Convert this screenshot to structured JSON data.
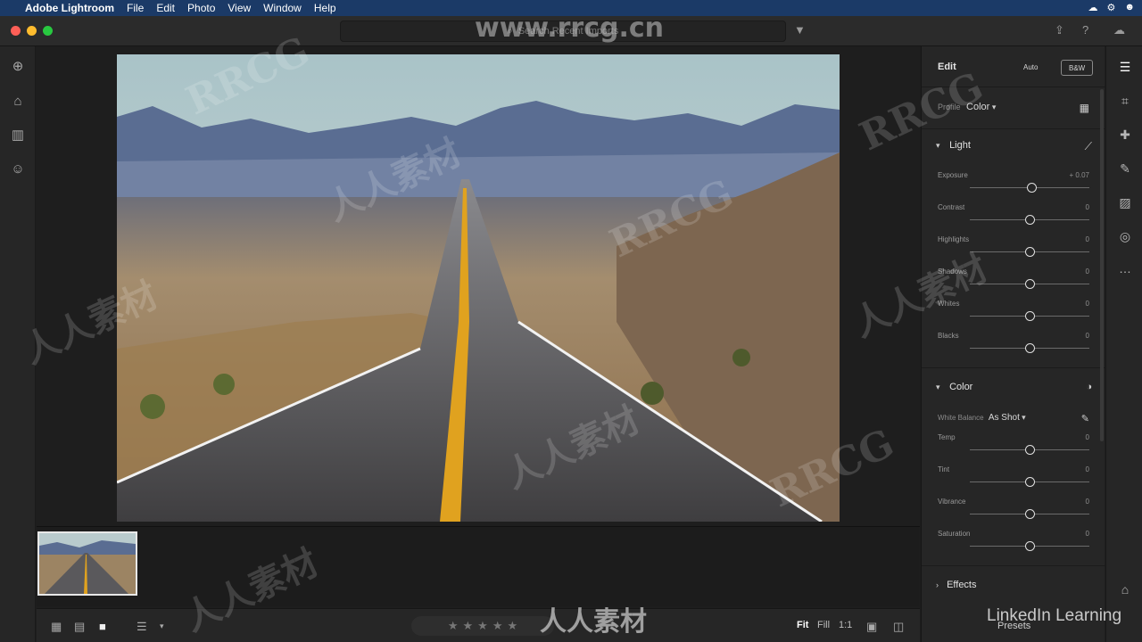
{
  "menubar": {
    "app_name": "Adobe Lightroom",
    "items": [
      "File",
      "Edit",
      "Photo",
      "View",
      "Window",
      "Help"
    ]
  },
  "titlebar": {
    "search_placeholder": "Search Recent Imports"
  },
  "edit_panel": {
    "title": "Edit",
    "auto_label": "Auto",
    "bw_label": "B&W",
    "profile_label": "Profile",
    "profile_value": "Color",
    "light": {
      "title": "Light",
      "sliders": [
        {
          "label": "Exposure",
          "value": "+ 0.07",
          "level": 0.52
        },
        {
          "label": "Contrast",
          "value": "0",
          "level": 0.5
        },
        {
          "label": "Highlights",
          "value": "0",
          "level": 0.5
        },
        {
          "label": "Shadows",
          "value": "0",
          "level": 0.5
        },
        {
          "label": "Whites",
          "value": "0",
          "level": 0.5
        },
        {
          "label": "Blacks",
          "value": "0",
          "level": 0.5
        }
      ]
    },
    "color": {
      "title": "Color",
      "white_balance_label": "White Balance",
      "white_balance_value": "As Shot",
      "sliders": [
        {
          "label": "Temp",
          "value": "0",
          "level": 0.5
        },
        {
          "label": "Tint",
          "value": "0",
          "level": 0.5
        },
        {
          "label": "Vibrance",
          "value": "0",
          "level": 0.5
        },
        {
          "label": "Saturation",
          "value": "0",
          "level": 0.5
        }
      ]
    },
    "effects_title": "Effects",
    "presets_label": "Presets"
  },
  "bottombar": {
    "fit_label": "Fit",
    "fill_label": "Fill",
    "one_to_one_label": "1:1"
  },
  "watermarks": {
    "site": "www.rrcg.cn",
    "brand": "LinkedIn Learning",
    "cn_text": "人人素材",
    "rrcg": "RRCG"
  },
  "colors": {
    "menubar_bg": "#1b3a67",
    "panel_bg": "#262626",
    "canvas_bg": "#1e1e1e"
  }
}
